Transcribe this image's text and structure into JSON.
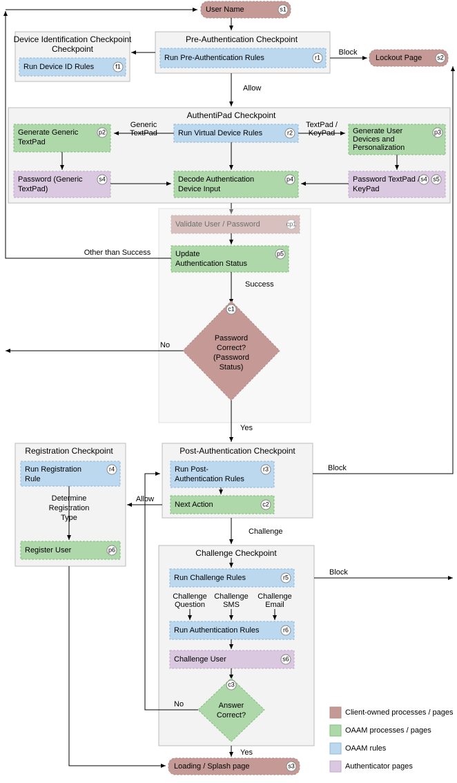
{
  "nodes": {
    "s1": {
      "label": "User Name",
      "tag": "s1"
    },
    "s2": {
      "label": "Lockout Page",
      "tag": "s2"
    },
    "f1": {
      "label": "Run Device ID Rules",
      "tag": "f1"
    },
    "r1": {
      "label": "Run Pre-Authentication Rules",
      "tag": "r1"
    },
    "r2": {
      "label": "Run Virtual Device Rules",
      "tag": "r2"
    },
    "p2": {
      "label": "Generate Generic TextPad",
      "tag": "p2"
    },
    "p3": {
      "label": "Generate User Devices and Personalization",
      "tag": "p3"
    },
    "p4": {
      "label": "Decode Authentication Device Input",
      "tag": "p4"
    },
    "s4a": {
      "label": "Password (Generic TextPad)",
      "tag": "s4"
    },
    "s4b": {
      "label": "Password TextPad / KeyPad",
      "tag": "s4",
      "tag2": "s5"
    },
    "cp1": {
      "label": "Validate User / Password",
      "tag": "cp1"
    },
    "p5": {
      "label": "Update Authentication Status",
      "tag": "p5"
    },
    "c1": {
      "label": "Password Correct? (Password Status)",
      "tag": "c1"
    },
    "r3": {
      "label": "Run Post-Authentication Rules",
      "tag": "r3"
    },
    "c2": {
      "label": "Next Action",
      "tag": "c2"
    },
    "r4": {
      "label": "Run Registration Rule",
      "tag": "r4"
    },
    "p6": {
      "label": "Register User",
      "tag": "p6"
    },
    "r5": {
      "label": "Run Challenge Rules",
      "tag": "r5"
    },
    "r6": {
      "label": "Run Authentication Rules",
      "tag": "r6"
    },
    "s6": {
      "label": "Challenge User",
      "tag": "s6"
    },
    "c3": {
      "label": "Answer Correct?",
      "tag": "c3"
    },
    "s3": {
      "label": "Loading / Splash page",
      "tag": "s3"
    }
  },
  "groups": {
    "device": "Device Identification Checkpoint",
    "preauth": "Pre-Authentication Checkpoint",
    "authentipad": "AuthentiPad Checkpoint",
    "postauth": "Post-Authentication Checkpoint",
    "registration": "Registration Checkpoint",
    "challenge": "Challenge Checkpoint"
  },
  "edges": {
    "preauth_block": "Block",
    "preauth_allow": "Allow",
    "generic_textpad": "Generic TextPad",
    "textpad_keypad": "TextPad / KeyPad",
    "other_success": "Other than Success",
    "success": "Success",
    "no": "No",
    "yes": "Yes",
    "block": "Block",
    "allow": "Allow",
    "challenge": "Challenge",
    "determine_reg": "Determine Registration Type",
    "chal_q": "Challenge Question",
    "chal_sms": "Challenge SMS",
    "chal_email": "Challenge Email"
  },
  "legend": {
    "client": "Client-owned processes / pages",
    "oaam": "OAAM processes / pages",
    "rules": "OAAM rules",
    "auth": "Authenticator pages"
  }
}
